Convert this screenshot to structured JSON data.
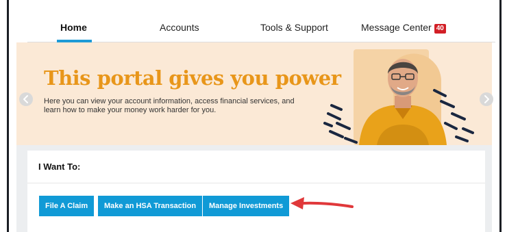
{
  "nav": {
    "tabs": [
      {
        "label": "Home"
      },
      {
        "label": "Accounts"
      },
      {
        "label": "Tools & Support"
      },
      {
        "label": "Message Center",
        "badge": "40"
      }
    ],
    "accent": "#1e9bd7",
    "badge_color": "#d21f26"
  },
  "hero": {
    "title": "This portal gives you power",
    "text": "Here you can view your account information, access financial services, and learn how to make your money work harder for you.",
    "title_color": "#e8961a",
    "background": "#fbe9d6",
    "prev_icon": "chevron-left-icon",
    "next_icon": "chevron-right-icon"
  },
  "actions": {
    "title": "I Want To:",
    "buttons": [
      {
        "label": "File A Claim"
      },
      {
        "label": "Make an HSA Transaction"
      },
      {
        "label": "Manage Investments"
      }
    ],
    "button_color": "#109ad6"
  },
  "annotation": {
    "arrow_color": "#e0383a"
  }
}
